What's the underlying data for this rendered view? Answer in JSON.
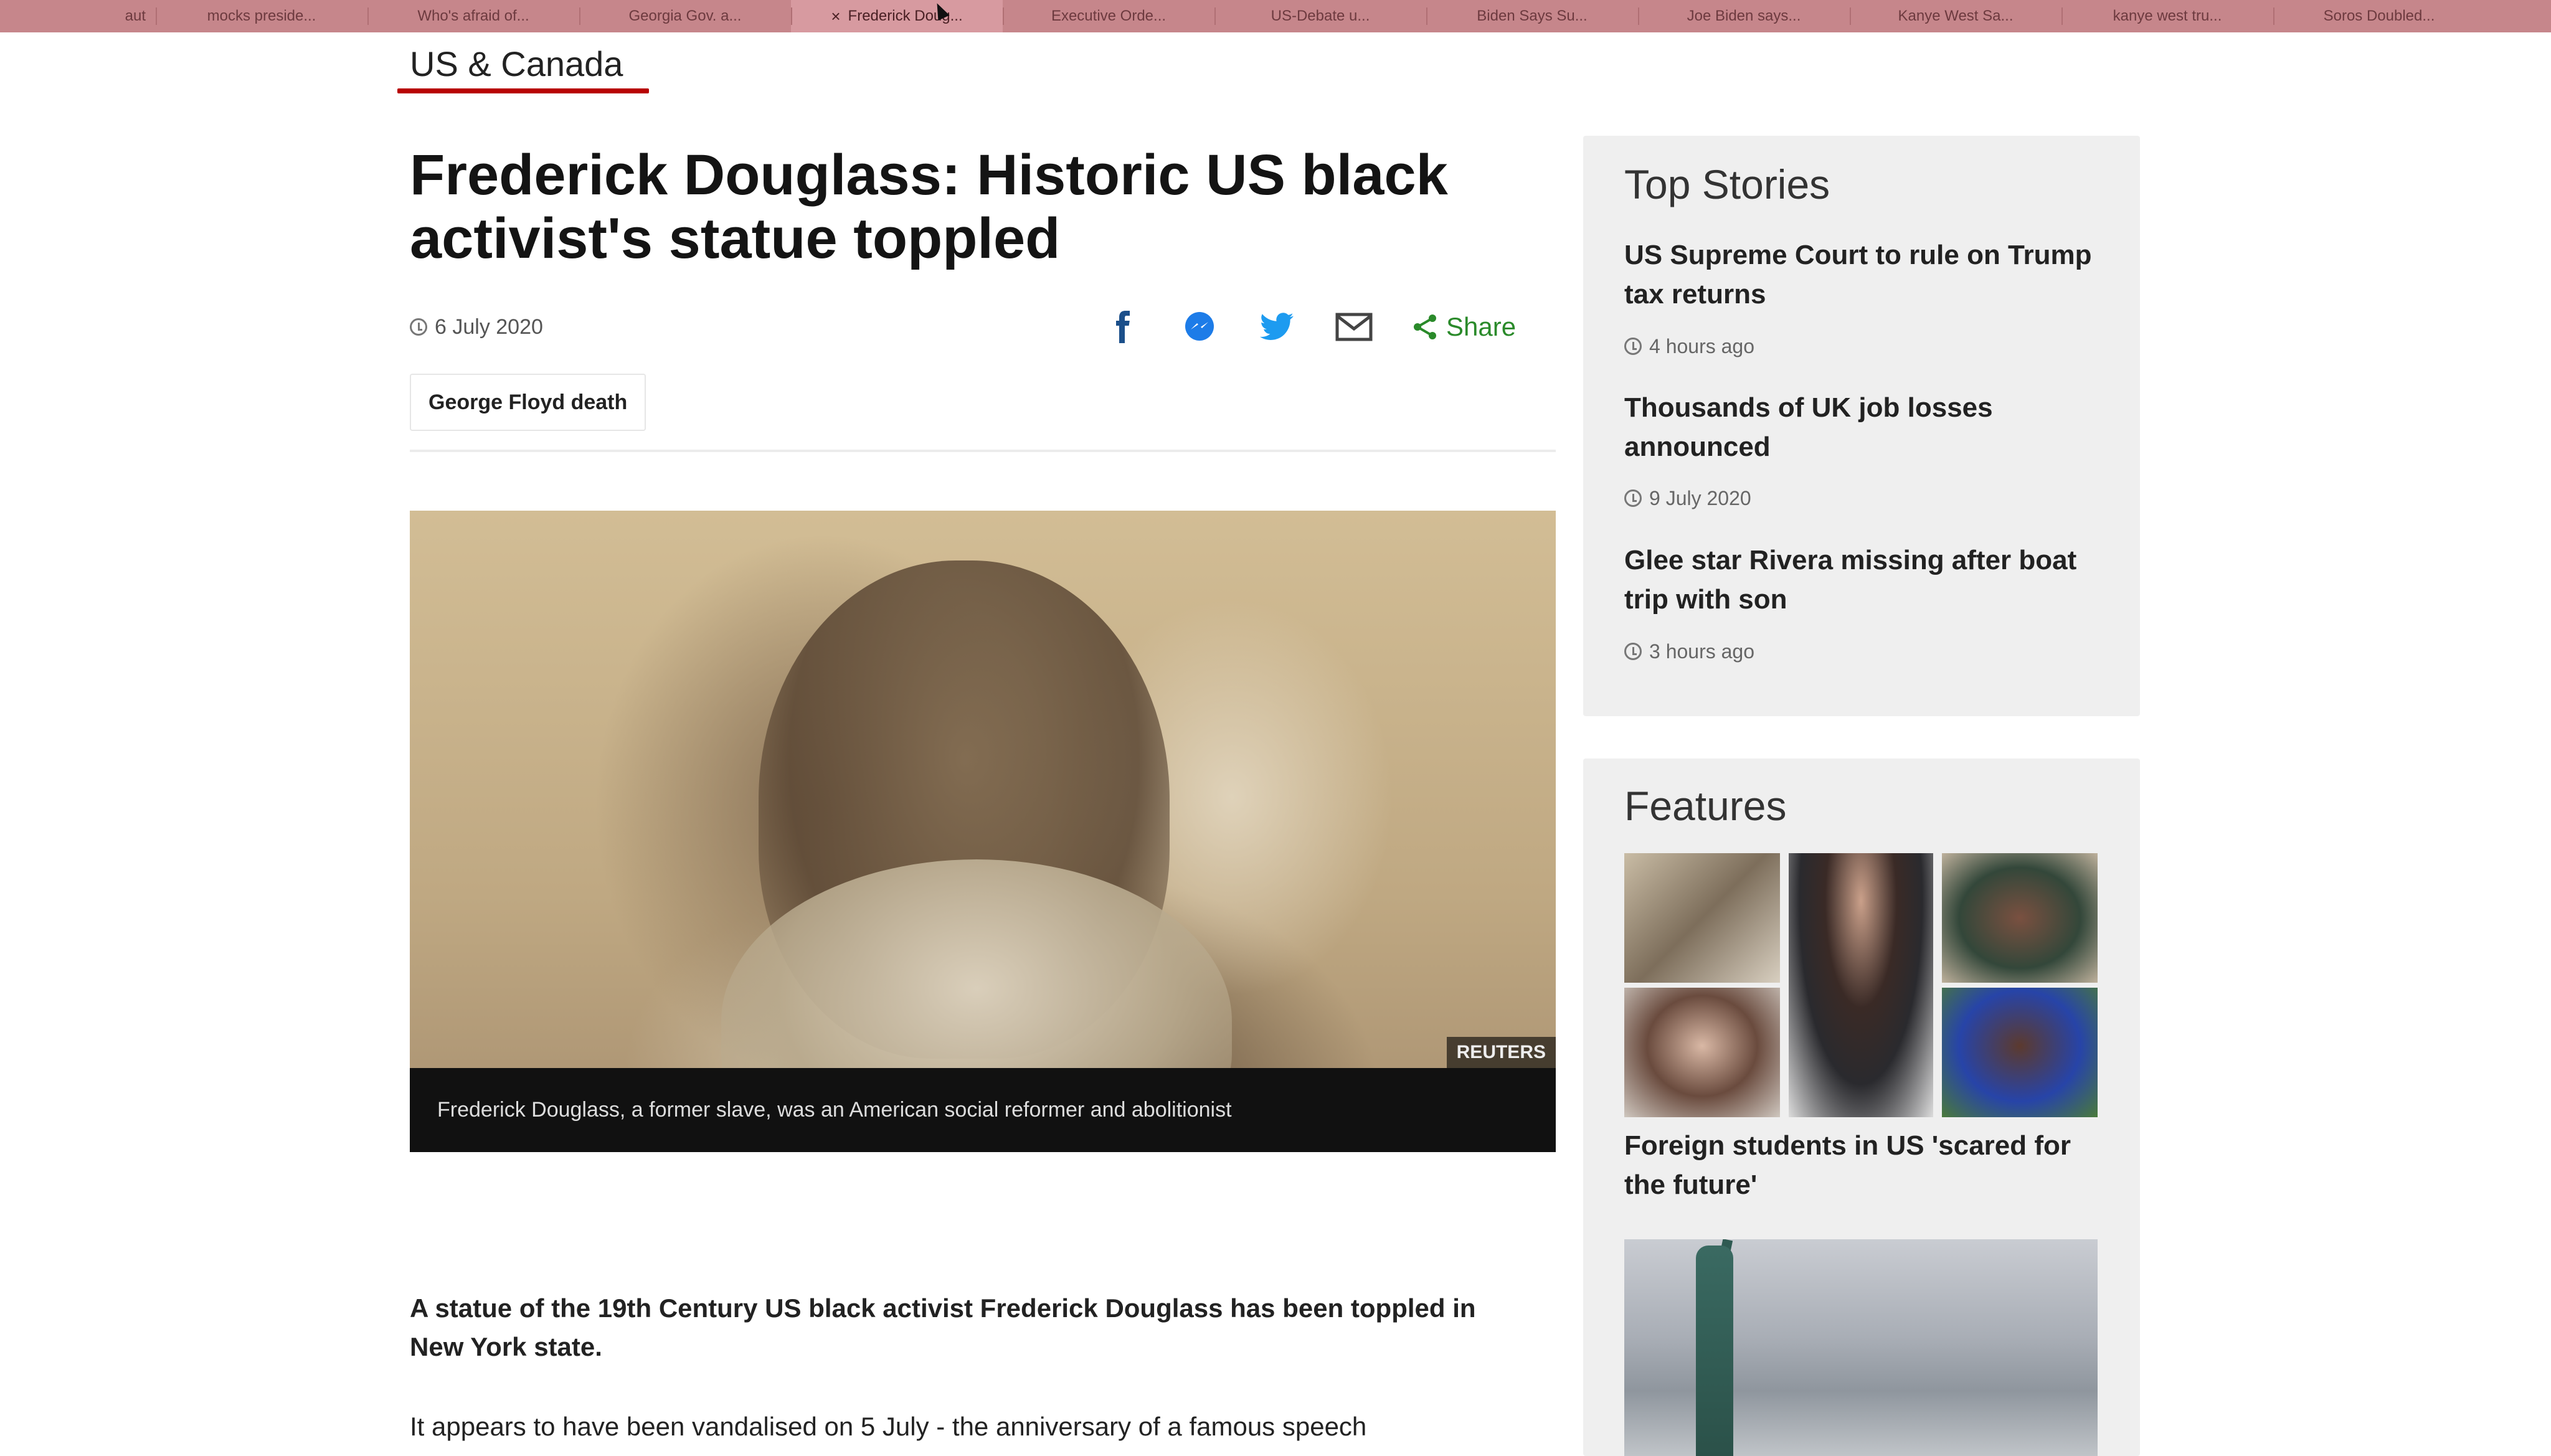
{
  "browser": {
    "tabs": [
      {
        "label": "aut",
        "active": false
      },
      {
        "label": "mocks preside...",
        "active": false
      },
      {
        "label": "Who's afraid of...",
        "active": false
      },
      {
        "label": "Georgia Gov. a...",
        "active": false
      },
      {
        "label": "Frederick Doug...",
        "active": true
      },
      {
        "label": "Executive Orde...",
        "active": false
      },
      {
        "label": "US-Debate u...",
        "active": false
      },
      {
        "label": "Biden Says Su...",
        "active": false
      },
      {
        "label": "Joe Biden says...",
        "active": false
      },
      {
        "label": "Kanye West Sa...",
        "active": false
      },
      {
        "label": "kanye west tru...",
        "active": false
      },
      {
        "label": "Soros Doubled...",
        "active": false
      }
    ],
    "close_glyph": "×",
    "tab_color": "#c6868b"
  },
  "article": {
    "section": "US & Canada",
    "headline": "Frederick Douglass: Historic US black activist's statue toppled",
    "date": "6 July 2020",
    "share_label": "Share",
    "tag": "George Floyd death",
    "image_credit": "REUTERS",
    "image_caption": "Frederick Douglass, a former slave, was an American social reformer and abolitionist",
    "lede": "A statue of the 19th Century US black activist Frederick Douglass has been toppled in New York state.",
    "para1": "It appears to have been vandalised on 5 July - the anniversary of a famous speech",
    "accent_color": "#b80000",
    "share_icons": [
      "facebook-icon",
      "messenger-icon",
      "twitter-icon",
      "email-icon",
      "share-icon"
    ]
  },
  "sidebar": {
    "top_stories": {
      "title": "Top Stories",
      "items": [
        {
          "title": "US Supreme Court to rule on Trump tax returns",
          "time": "4 hours ago"
        },
        {
          "title": "Thousands of UK job losses announced",
          "time": "9 July 2020"
        },
        {
          "title": "Glee star Rivera missing after boat trip with son",
          "time": "3 hours ago"
        }
      ]
    },
    "features": {
      "title": "Features",
      "items": [
        {
          "title": "Foreign students in US 'scared for the future'"
        }
      ]
    }
  }
}
